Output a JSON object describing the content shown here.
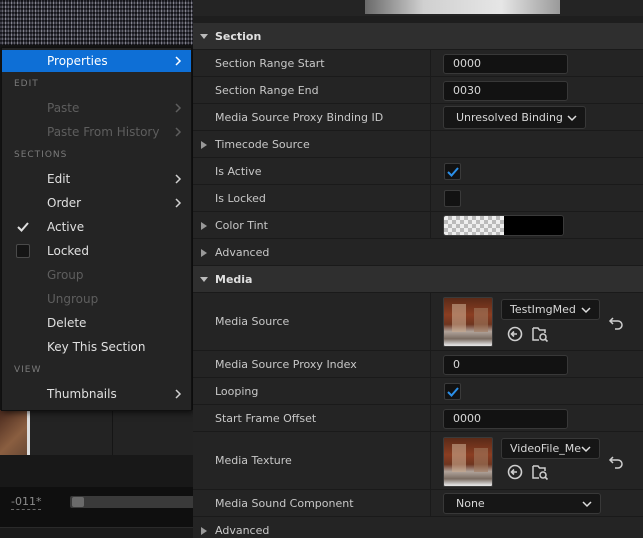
{
  "timeline": {
    "frame_label": "-011*"
  },
  "context_menu": {
    "items_top": [
      {
        "label": "Properties",
        "has_submenu": true,
        "highlighted": true
      }
    ],
    "sections": [
      "EDIT",
      "SECTIONS",
      "VIEW"
    ],
    "edit_items": [
      {
        "label": "Paste",
        "disabled": true,
        "has_submenu": true
      },
      {
        "label": "Paste From History",
        "disabled": true,
        "has_submenu": true
      }
    ],
    "section_items": [
      {
        "label": "Edit",
        "has_submenu": true
      },
      {
        "label": "Order",
        "has_submenu": true
      },
      {
        "label": "Active",
        "checked": true
      },
      {
        "label": "Locked",
        "checked": false
      },
      {
        "label": "Group",
        "disabled": true
      },
      {
        "label": "Ungroup",
        "disabled": true
      },
      {
        "label": "Delete"
      },
      {
        "label": "Key This Section"
      }
    ],
    "view_items": [
      {
        "label": "Thumbnails",
        "has_submenu": true
      }
    ]
  },
  "details": {
    "section_header": "Section",
    "section_range_start": {
      "label": "Section Range Start",
      "value": "0000"
    },
    "section_range_end": {
      "label": "Section Range End",
      "value": "0030"
    },
    "proxy_binding_id": {
      "label": "Media Source Proxy Binding ID",
      "value": "Unresolved Binding"
    },
    "timecode_source": {
      "label": "Timecode Source"
    },
    "is_active": {
      "label": "Is Active",
      "checked": true
    },
    "is_locked": {
      "label": "Is Locked",
      "checked": false
    },
    "color_tint": {
      "label": "Color Tint"
    },
    "advanced_1": {
      "label": "Advanced"
    },
    "media_header": "Media",
    "media_source": {
      "label": "Media Source",
      "value": "TestImgMed"
    },
    "media_source_proxy_index": {
      "label": "Media Source Proxy Index",
      "value": "0"
    },
    "looping": {
      "label": "Looping",
      "checked": true
    },
    "start_frame_offset": {
      "label": "Start Frame Offset",
      "value": "0000"
    },
    "media_texture": {
      "label": "Media Texture",
      "value": "VideoFile_Me"
    },
    "media_sound_component": {
      "label": "Media Sound Component",
      "value": "None"
    },
    "advanced_2": {
      "label": "Advanced"
    }
  },
  "colors": {
    "highlight": "#0e6fd6",
    "check": "#2b8fe8"
  }
}
